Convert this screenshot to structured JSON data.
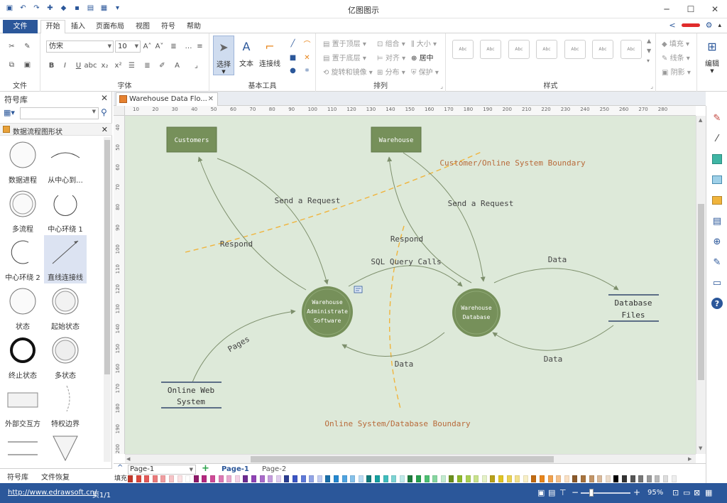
{
  "app": {
    "title": "亿图图示"
  },
  "tabs": {
    "file": "文件",
    "home": "开始",
    "insert": "插入",
    "layout": "页面布局",
    "view": "视图",
    "symbol": "符号",
    "help": "帮助"
  },
  "ribbon": {
    "groups": {
      "file": "文件",
      "font": "字体",
      "basic_tools": "基本工具",
      "arrange": "排列",
      "styles": "样式",
      "edit": "编辑"
    },
    "font_name": "仿宋",
    "font_size": "10",
    "tools": {
      "select": "选择",
      "text": "文本",
      "connector": "连接线"
    },
    "arrange": {
      "bring_front": "置于顶层",
      "send_back": "置于底层",
      "rotate": "旋转和镜像",
      "group": "组合",
      "align": "对齐",
      "distribute": "分布",
      "size": "大小",
      "center": "居中",
      "protect": "保护"
    },
    "style_sample": "Abc",
    "fill": "填充",
    "line": "线条",
    "shadow": "阴影"
  },
  "library": {
    "title": "符号库",
    "category": "数据流程图形状",
    "shapes": [
      "数据进程",
      "从中心到...",
      "多流程",
      "中心环绕 1",
      "中心环绕 2",
      "直线连接线",
      "状态",
      "起始状态",
      "终止状态",
      "多状态",
      "外部交互方",
      "特权边界"
    ],
    "tabs": [
      "符号库",
      "文件恢复"
    ]
  },
  "document": {
    "tab": "Warehouse Data Flo...",
    "pages": [
      "Page-1",
      "Page-2"
    ],
    "page_selector": "Page-1"
  },
  "ruler": {
    "h": [
      "10",
      "20",
      "30",
      "40",
      "50",
      "60",
      "70",
      "80",
      "90",
      "100",
      "110",
      "120",
      "130",
      "140",
      "150",
      "160",
      "170",
      "180",
      "190",
      "200",
      "210",
      "220",
      "230",
      "240",
      "250",
      "260",
      "270",
      "280"
    ],
    "v": [
      "40",
      "50",
      "60",
      "70",
      "80",
      "90",
      "100",
      "110",
      "120",
      "130",
      "140",
      "150",
      "160",
      "170",
      "180",
      "190",
      "200"
    ]
  },
  "diagram": {
    "entities": {
      "customers": "Customers",
      "warehouse": "Warehouse"
    },
    "processes": {
      "was": [
        "Warehouse",
        "Administrate",
        "Software"
      ],
      "wdb": [
        "Warehouse",
        "Database"
      ]
    },
    "stores": {
      "db_files": [
        "Database",
        "Files"
      ],
      "online_web": [
        "Online Web",
        "System"
      ]
    },
    "flows": {
      "send1": "Send a Request",
      "respond1": "Respond",
      "send2": "Send a Request",
      "respond2": "Respond",
      "sql": "SQL Query Calls",
      "data_top": "Data",
      "data_right": "Data",
      "data_bottom": "Data",
      "pages": "Pages"
    },
    "boundaries": {
      "customer": "Customer/Online System Boundary",
      "database": "Online System/Database Boundary"
    },
    "colors": {
      "canvas": "#dde9d9",
      "node": "#76905a",
      "line": "#7d8f6c",
      "boundary": "#f0b43c",
      "boundary_text": "#b86a3a"
    }
  },
  "palette": {
    "label": "填充",
    "colors": [
      "#c0392b",
      "#d9473c",
      "#e35a59",
      "#ea7a7b",
      "#f09da0",
      "#f6c3c6",
      "#fbe2e4",
      "#ffffff",
      "#8e1b6a",
      "#b3287f",
      "#cf4a97",
      "#dd78b4",
      "#eaa8cf",
      "#f4d2e6",
      "#6d2c91",
      "#8f43b5",
      "#a96bca",
      "#c59cde",
      "#e0cdee",
      "#2c3e91",
      "#3b55c4",
      "#5f7ad8",
      "#91a4e6",
      "#c3cdf2",
      "#1a6ea8",
      "#2487cf",
      "#4fa3e0",
      "#85c1ea",
      "#bcdcf4",
      "#117a7a",
      "#16a0a0",
      "#3fbcbc",
      "#7dd3d3",
      "#bfeaea",
      "#1e7a3c",
      "#27a04e",
      "#4dbf72",
      "#86d6a0",
      "#c2ebcf",
      "#6a8f1e",
      "#8cb82a",
      "#a9cf53",
      "#c8e28c",
      "#e4f1c6",
      "#b8a11a",
      "#e0c423",
      "#ead151",
      "#f2e08c",
      "#f8efc6",
      "#c26b12",
      "#e8851b",
      "#f0a14d",
      "#f5c08a",
      "#fae0c4",
      "#8a5a2b",
      "#a8743e",
      "#c29466",
      "#d9b999",
      "#ecdccb",
      "#000000",
      "#333333",
      "#555555",
      "#777777",
      "#999999",
      "#bbbbbb",
      "#dddddd",
      "#eeeeee"
    ]
  },
  "status": {
    "url": "http://www.edrawsoft.cn/",
    "page": "页1/1",
    "zoom": "95%"
  }
}
